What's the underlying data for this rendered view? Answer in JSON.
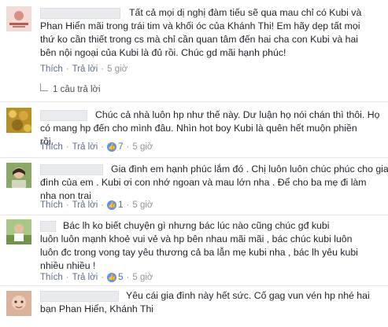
{
  "comments": [
    {
      "lines": [
        "Tất cả mọi dị nghị đàm tiếu sẽ qua mau chỉ có Kubi và",
        "Phan Hiển mãi trong trái tim và khối óc của Khánh Thi! Em hãy dẹp tất mọi",
        "thứ ko cần thiết trong cs mà chỉ cần quan tâm đến hai cha con Kubi và hai",
        "bên nội ngoại của Kubi là đủ rồi. Chúc gd mãi hạnh phúc!"
      ],
      "like": "Thích",
      "reply": "Trả lời",
      "time": "5 giờ",
      "reply_count": "1 câu trả lời"
    },
    {
      "lines": [
        "Chúc cả nhà luôn hp như thế này. Dư luận họ nói chán thì thôi. Họ",
        "có mang hp đến cho mình đâu. Nhìn hot boy Kubi là quên hết muộn phiền",
        "rồi."
      ],
      "like": "Thích",
      "reply": "Trả lời",
      "likes": "7",
      "time": "5 giờ"
    },
    {
      "lines": [
        "Gia đình em hạnh phúc lắm đó . Chị luôn luôn chúc phúc cho gia",
        "đình của em . Kubi ơi con nhớ ngoan và mau lớn nha . Để cho ba mẹ đi làm",
        "nha non trai"
      ],
      "like": "Thích",
      "reply": "Trả lời",
      "likes": "1",
      "time": "5 giờ"
    },
    {
      "lines": [
        "Bác lh ko biết chuyện gì nhưng bác lúc nào cũng chúc gđ kubi",
        "luôn luôn mạnh khoẻ vui vẻ và hp bên nhau mãi mãi , bác chúc kubi luôn",
        "luôn đc trong vong tay yêu thương cả ba lẫn mẹ kubi nha , bác lh yêu kubi",
        "nhiều nhiều !"
      ],
      "like": "Thích",
      "reply": "Trả lời",
      "likes": "5",
      "time": "5 giờ"
    },
    {
      "lines": [
        "Yêu cái gia đình này hết sức. Cố gag vun vén hp nhé hai",
        "bạn Phan Hiển, Khánh Thi"
      ]
    }
  ],
  "avatar_colors": {
    "c1": "#e9c7c2",
    "c2": "#c9a53a",
    "c3": "#6f8a53",
    "c4": "#9bbf74",
    "c5": "#cfa489"
  }
}
